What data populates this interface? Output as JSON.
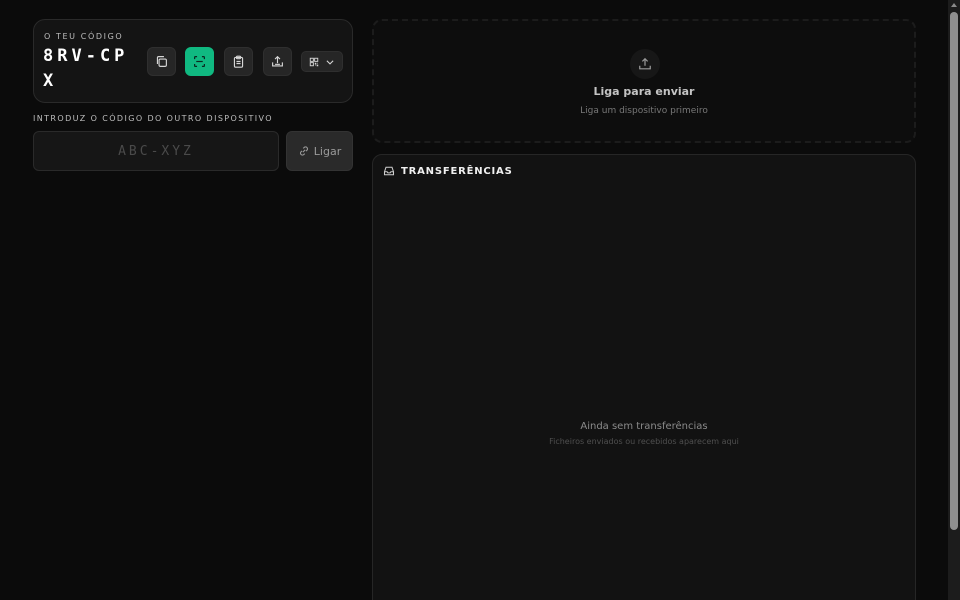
{
  "code_card": {
    "label": "O TEU CÓDIGO",
    "code": "8RV-CPX",
    "actions": [
      {
        "name": "copy-icon",
        "accent": false
      },
      {
        "name": "scan-icon",
        "accent": true
      },
      {
        "name": "clipboard-icon",
        "accent": false
      },
      {
        "name": "share-upload-icon",
        "accent": false
      }
    ],
    "qr_menu_icon": "qr-code-icon"
  },
  "connect": {
    "label": "INTRODUZ O CÓDIGO DO OUTRO DISPOSITIVO",
    "placeholder": "ABC-XYZ",
    "value": "",
    "button_label": "Ligar"
  },
  "send_zone": {
    "title": "Liga para enviar",
    "subtitle": "Liga um dispositivo primeiro"
  },
  "transfers": {
    "title": "TRANSFERÊNCIAS",
    "empty_title": "Ainda sem transferências",
    "empty_subtitle": "Ficheiros enviados ou recebidos aparecem aqui"
  },
  "colors": {
    "accent": "#10b981",
    "background": "#0b0b0b",
    "card": "#141414"
  }
}
